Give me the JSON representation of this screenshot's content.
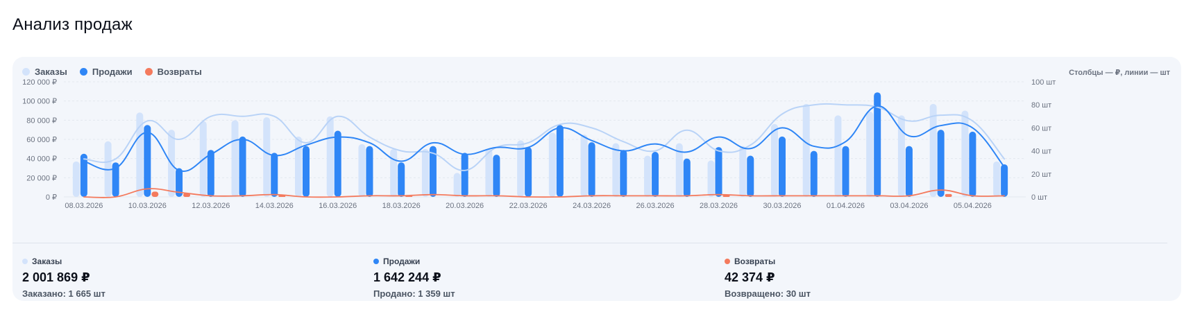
{
  "page": {
    "title": "Анализ продаж"
  },
  "legend": {
    "orders_label": "Заказы",
    "sales_label": "Продажи",
    "returns_label": "Возвраты"
  },
  "unit_note": "Столбцы — ₽, линии — шт",
  "colors": {
    "orders": "#d3e3fb",
    "orders_line": "#b9d3f7",
    "sales": "#2f86f6",
    "returns": "#f47a5d",
    "grid": "#e3e8ef",
    "tick": "#6b7280",
    "card_bg": "#f3f6fb"
  },
  "chart_data": {
    "type": "bar",
    "title": "",
    "legend_position": "top-left",
    "grid": true,
    "y_left": {
      "ylim": [
        0,
        120000
      ],
      "ticks": [
        0,
        20000,
        40000,
        60000,
        80000,
        100000,
        120000
      ],
      "tick_labels": [
        "0 ₽",
        "20 000 ₽",
        "40 000 ₽",
        "60 000 ₽",
        "80 000 ₽",
        "100 000 ₽",
        "120 000 ₽"
      ]
    },
    "y_right": {
      "ylim": [
        0,
        100
      ],
      "ticks": [
        0,
        20,
        40,
        60,
        80,
        100
      ],
      "tick_labels": [
        "0 шт",
        "20 шт",
        "40 шт",
        "60 шт",
        "80 шт",
        "100 шт"
      ]
    },
    "x": [
      "08.03.2026",
      "09.03.2026",
      "10.03.2026",
      "11.03.2026",
      "12.03.2026",
      "13.03.2026",
      "14.03.2026",
      "15.03.2026",
      "16.03.2026",
      "17.03.2026",
      "18.03.2026",
      "19.03.2026",
      "20.03.2026",
      "21.03.2026",
      "22.03.2026",
      "23.03.2026",
      "24.03.2026",
      "25.03.2026",
      "26.03.2026",
      "27.03.2026",
      "28.03.2026",
      "29.03.2026",
      "30.03.2026",
      "31.03.2026",
      "01.04.2026",
      "02.04.2026",
      "03.04.2026",
      "04.04.2026",
      "05.04.2026",
      "06.04.2026"
    ],
    "x_tick_labels": [
      "08.03.2026",
      "10.03.2026",
      "12.03.2026",
      "14.03.2026",
      "16.03.2026",
      "18.03.2026",
      "20.03.2026",
      "22.03.2026",
      "24.03.2026",
      "26.03.2026",
      "28.03.2026",
      "30.03.2026",
      "01.04.2026",
      "03.04.2026",
      "05.04.2026"
    ],
    "bar_series": [
      {
        "name": "Заказы",
        "values": [
          37000,
          58000,
          88000,
          70000,
          79000,
          80000,
          83000,
          63000,
          84000,
          55000,
          50000,
          50000,
          25000,
          50000,
          59000,
          67000,
          65000,
          56000,
          43000,
          56000,
          38000,
          53000,
          76000,
          97000,
          85000,
          89000,
          85000,
          97000,
          90000,
          37000
        ]
      },
      {
        "name": "Продажи",
        "values": [
          45000,
          36000,
          75000,
          30000,
          49000,
          63000,
          46000,
          53000,
          69000,
          53000,
          36000,
          53000,
          46000,
          44000,
          52000,
          75000,
          57000,
          49000,
          47000,
          40000,
          52000,
          43000,
          63000,
          48000,
          53000,
          109000,
          53000,
          70000,
          68000,
          34000
        ]
      },
      {
        "name": "Возвраты",
        "values": [
          0,
          0,
          5500,
          4000,
          0,
          0,
          1500,
          0,
          0,
          0,
          1000,
          0,
          0,
          0,
          0,
          0,
          0,
          0,
          0,
          0,
          1800,
          0,
          0,
          0,
          0,
          0,
          0,
          3000,
          0,
          0
        ]
      }
    ],
    "line_series": [
      {
        "name": "Заказы",
        "values": [
          33,
          33,
          66,
          50,
          70,
          70,
          70,
          47,
          70,
          52,
          40,
          38,
          23,
          43,
          47,
          63,
          60,
          48,
          40,
          58,
          40,
          45,
          72,
          80,
          80,
          78,
          66,
          71,
          66,
          33
        ]
      },
      {
        "name": "Продажи",
        "values": [
          31,
          25,
          56,
          23,
          37,
          50,
          36,
          45,
          52,
          47,
          31,
          47,
          37,
          43,
          43,
          60,
          49,
          40,
          46,
          39,
          52,
          42,
          60,
          44,
          48,
          79,
          53,
          62,
          60,
          26
        ]
      },
      {
        "name": "Возвраты",
        "values": [
          0,
          0,
          7,
          4,
          1,
          1,
          2,
          0,
          0,
          1,
          1,
          2,
          1,
          1,
          0,
          0,
          1,
          1,
          1,
          1,
          2,
          1,
          1,
          1,
          1,
          1,
          1,
          6,
          1,
          1
        ]
      }
    ]
  },
  "summary": [
    {
      "label": "Заказы",
      "value": "2 001 869 ₽",
      "sub": "Заказано: 1 665 шт"
    },
    {
      "label": "Продажи",
      "value": "1 642 244 ₽",
      "sub": "Продано: 1 359 шт"
    },
    {
      "label": "Возвраты",
      "value": "42 374 ₽",
      "sub": "Возвращено: 30 шт"
    }
  ]
}
